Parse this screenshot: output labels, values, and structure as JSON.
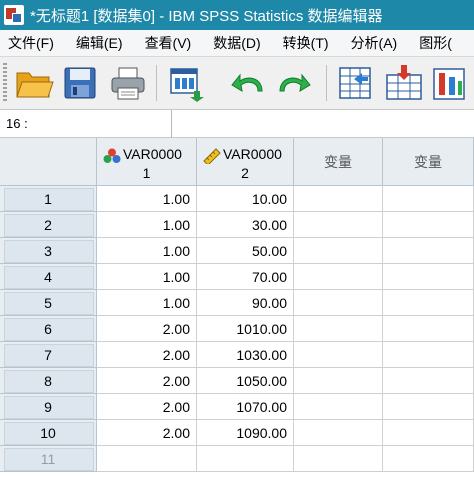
{
  "window": {
    "title": "*无标题1 [数据集0] - IBM SPSS Statistics 数据编辑器"
  },
  "menu": [
    "文件(F)",
    "编辑(E)",
    "查看(V)",
    "数据(D)",
    "转换(T)",
    "分析(A)",
    "图形("
  ],
  "toolbar": {
    "buttons": [
      "open-icon",
      "save-icon",
      "print-icon",
      "dialog-recall-icon",
      "undo-icon",
      "redo-icon",
      "goto-case-icon",
      "goto-variable-icon",
      "variables-icon"
    ]
  },
  "cellbar": {
    "ref": "16 :",
    "value": ""
  },
  "columns": [
    {
      "l1": "VAR0000",
      "l2": "1",
      "icon": "nominal-icon"
    },
    {
      "l1": "VAR0000",
      "l2": "2",
      "icon": "scale-ruler-icon"
    },
    {
      "label": "变量"
    },
    {
      "label": "变量"
    }
  ],
  "rows": [
    {
      "n": "1",
      "v1": "1.00",
      "v2": "10.00"
    },
    {
      "n": "2",
      "v1": "1.00",
      "v2": "30.00"
    },
    {
      "n": "3",
      "v1": "1.00",
      "v2": "50.00"
    },
    {
      "n": "4",
      "v1": "1.00",
      "v2": "70.00"
    },
    {
      "n": "5",
      "v1": "1.00",
      "v2": "90.00"
    },
    {
      "n": "6",
      "v1": "2.00",
      "v2": "1010.00"
    },
    {
      "n": "7",
      "v1": "2.00",
      "v2": "1030.00"
    },
    {
      "n": "8",
      "v1": "2.00",
      "v2": "1050.00"
    },
    {
      "n": "9",
      "v1": "2.00",
      "v2": "1070.00"
    },
    {
      "n": "10",
      "v1": "2.00",
      "v2": "1090.00"
    },
    {
      "n": "11",
      "v1": "",
      "v2": ""
    }
  ]
}
